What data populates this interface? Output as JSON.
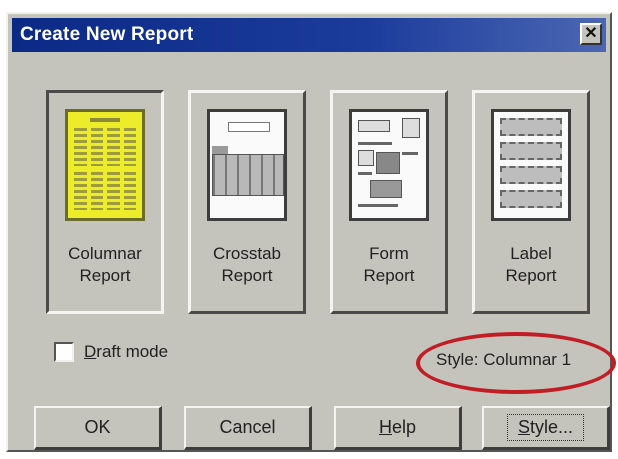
{
  "dialog": {
    "title": "Create New Report",
    "close_icon": "close-icon"
  },
  "report_types": [
    {
      "label": "Columnar\nReport",
      "selected": true
    },
    {
      "label": "Crosstab\nReport",
      "selected": false
    },
    {
      "label": "Form\nReport",
      "selected": false
    },
    {
      "label": "Label\nReport",
      "selected": false
    }
  ],
  "draft_mode": {
    "label": "Draft mode",
    "checked": false
  },
  "style_info": "Style: Columnar 1",
  "buttons": {
    "ok": "OK",
    "cancel": "Cancel",
    "help": "Help",
    "style": "Style..."
  },
  "colors": {
    "titlebar": "#0b2a86",
    "dialog_face": "#c4c3bc",
    "highlight_circle": "#c21d24",
    "columnar_thumb": "#ecec2a"
  }
}
